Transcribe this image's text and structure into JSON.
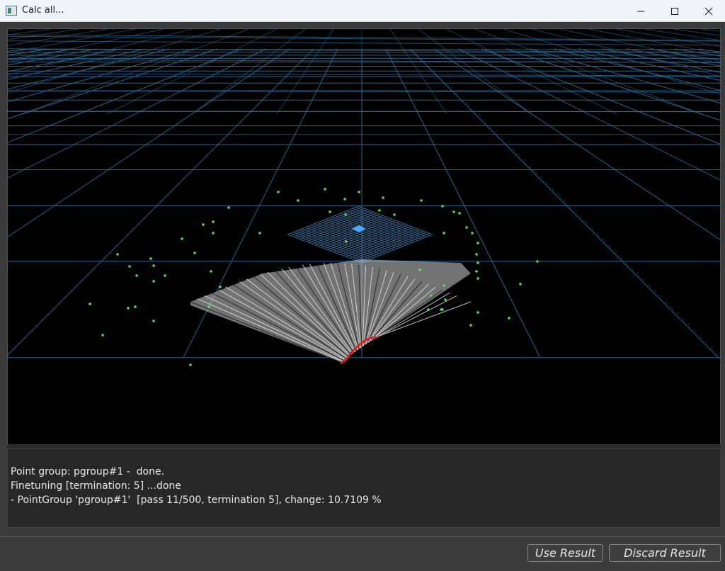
{
  "window": {
    "title": "Calc all...",
    "controls": {
      "minimize": "minimize",
      "maximize": "maximize",
      "close": "close"
    }
  },
  "log": {
    "lines": [
      "Point group: pgroup#1 -  done.",
      "Finetuning [termination: 5] ...done",
      "- PointGroup 'pgroup#1'  [pass 11/500, termination 5], change: 10.7109 %"
    ]
  },
  "buttons": {
    "use_result": "Use Result",
    "discard_result": "Discard Result"
  },
  "colors": {
    "grid": "#2f6f9a",
    "points": "#55e055",
    "fan": "#e8e8e8",
    "fan_edge": "#e02020",
    "center_marker": "#4aa8ff",
    "inner_grid": "#3d7fb0"
  }
}
